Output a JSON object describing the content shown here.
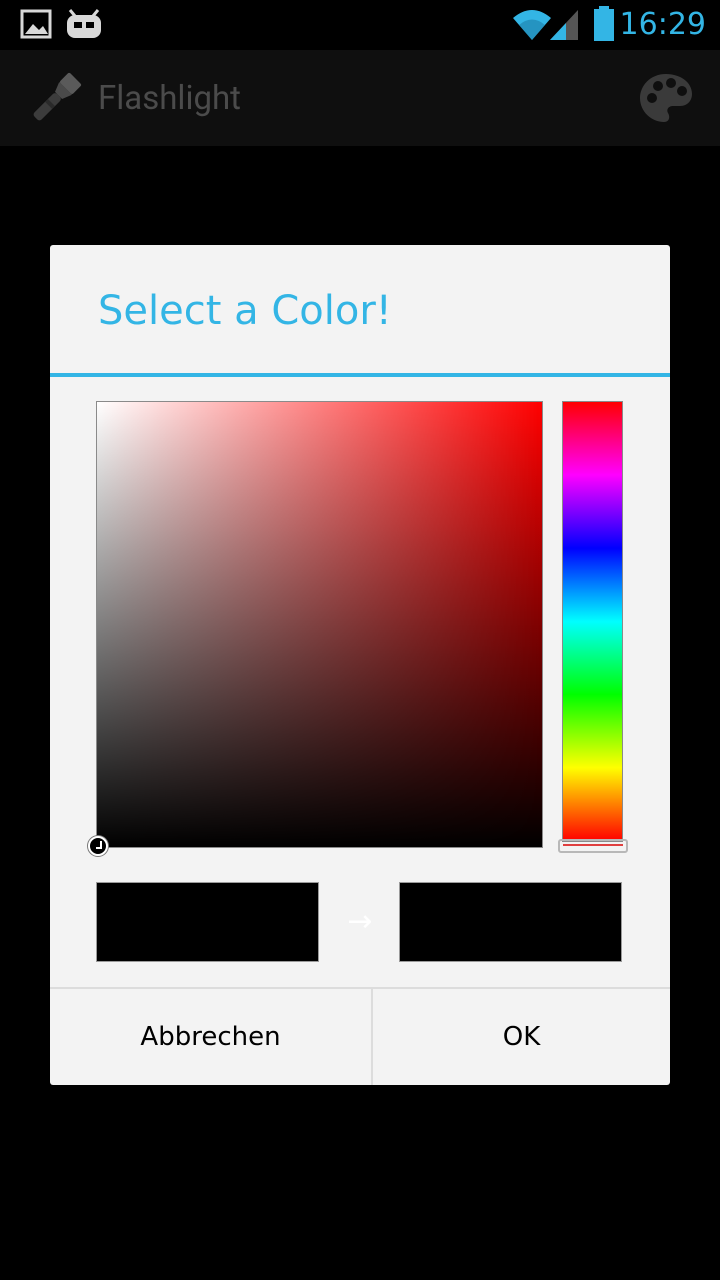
{
  "status_bar": {
    "time": "16:29",
    "icons": [
      "gallery-notification-icon",
      "cyanogenmod-notification-icon",
      "wifi-icon",
      "cell-signal-icon",
      "battery-icon"
    ],
    "accent_color": "#33b5e5"
  },
  "action_bar": {
    "title": "Flashlight",
    "app_icon": "flashlight-icon",
    "action_icon": "palette-icon"
  },
  "dialog": {
    "title": "Select a Color!",
    "title_color": "#33b5e5",
    "selected_hue": "#ff0000",
    "old_color": "#000000",
    "new_color": "#000000",
    "arrow_glyph": "→",
    "buttons": {
      "cancel_label": "Abbrechen",
      "ok_label": "OK"
    }
  }
}
